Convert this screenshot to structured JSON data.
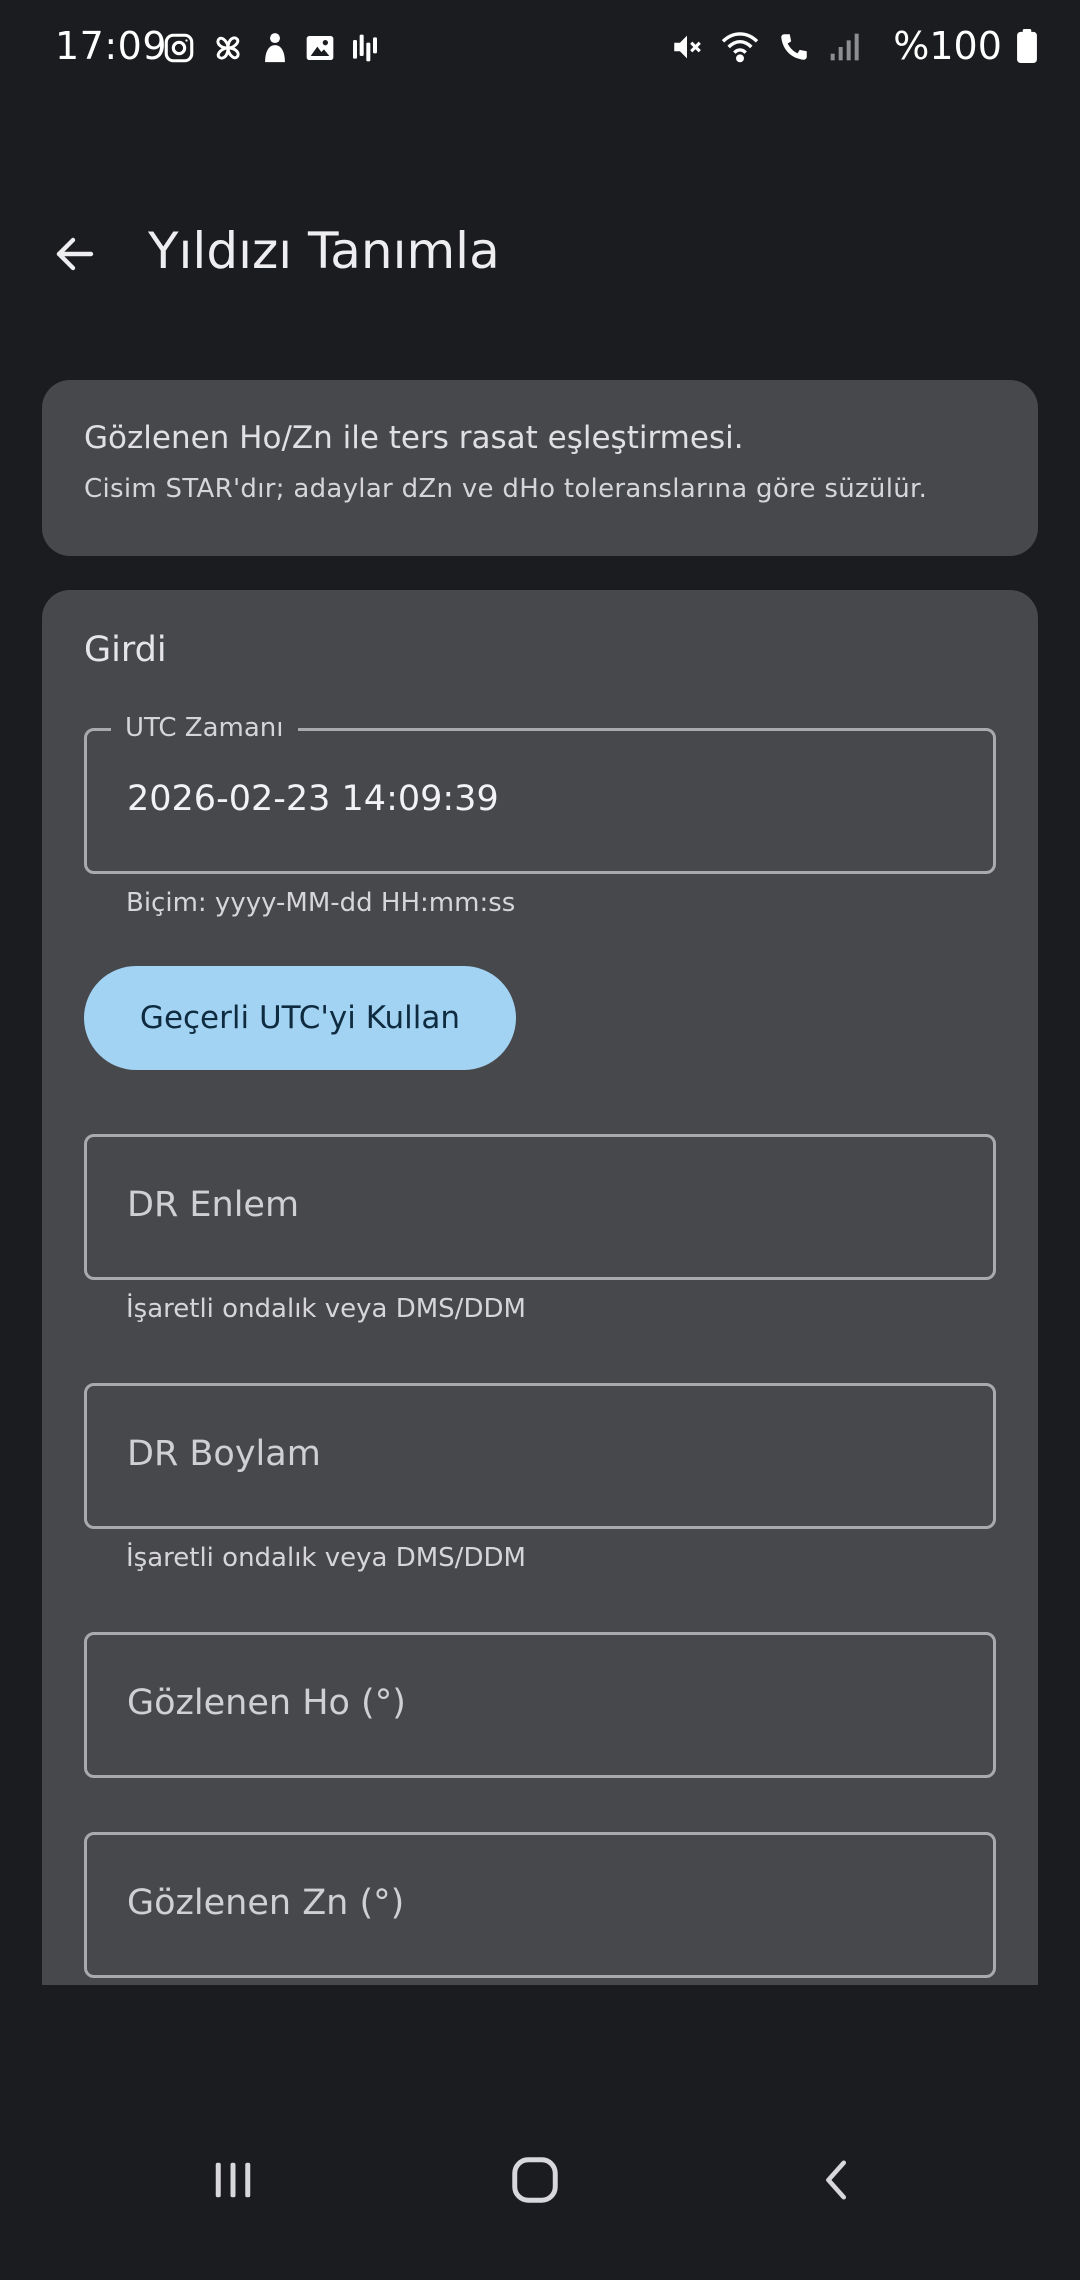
{
  "status_bar": {
    "time": "17:09",
    "battery_text": "%100",
    "left_icons": [
      "instagram-icon",
      "pinwheel-icon",
      "app-icon",
      "image-icon",
      "audio-bars-icon"
    ],
    "right_icons": [
      "mute-icon",
      "wifi-icon",
      "wifi-call-icon",
      "signal-icon",
      "battery-icon"
    ]
  },
  "app_bar": {
    "title": "Yıldızı Tanımla",
    "back_icon": "arrow-back-icon"
  },
  "info_card": {
    "line1": "Gözlenen Ho/Zn ile ters rasat eşleştirmesi.",
    "line2": "Cisim STAR'dır; adaylar dZn ve dHo toleranslarına göre süzülür."
  },
  "input_card": {
    "section_title": "Girdi",
    "utc_field": {
      "label": "UTC Zamanı",
      "value": "2026-02-23 14:09:39",
      "helper": "Biçim: yyyy-MM-dd HH:mm:ss"
    },
    "utc_button_label": "Geçerli UTC'yi Kullan",
    "lat_field": {
      "placeholder": "DR Enlem",
      "helper": "İşaretli ondalık veya DMS/DDM"
    },
    "lon_field": {
      "placeholder": "DR Boylam",
      "helper": "İşaretli ondalık veya DMS/DDM"
    },
    "ho_field": {
      "placeholder": "Gözlenen Ho (°)"
    },
    "zn_field": {
      "placeholder": "Gözlenen Zn (°)"
    }
  },
  "nav_bar": {
    "items": [
      "recent-apps-icon",
      "home-icon",
      "back-icon"
    ]
  },
  "colors": {
    "background": "#1b1c1f",
    "card": "#47484c",
    "accent_button": "#a3d3f3",
    "field_border": "#a9aaae"
  }
}
